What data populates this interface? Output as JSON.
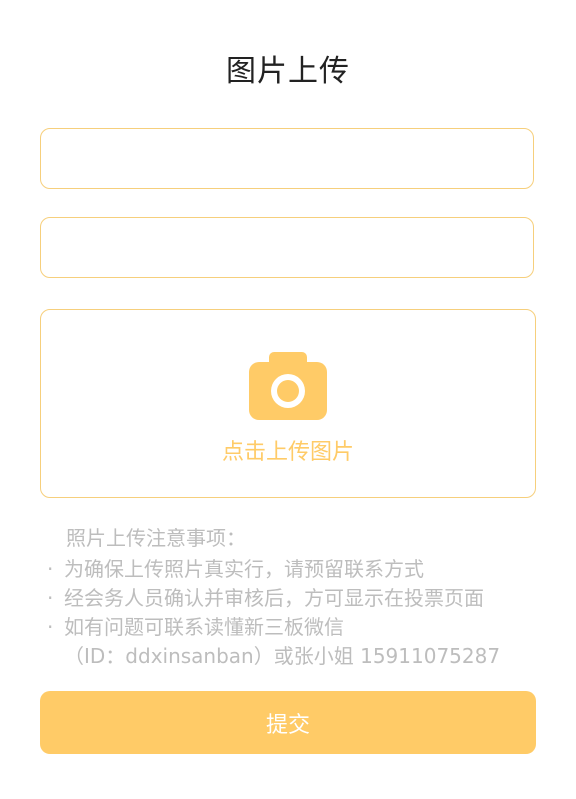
{
  "header": {
    "title": "图片上传"
  },
  "form": {
    "field_1": {
      "value": "",
      "placeholder": ""
    },
    "field_2": {
      "value": "",
      "placeholder": ""
    },
    "upload": {
      "icon": "camera-icon",
      "label": "点击上传图片"
    },
    "submit_label": "提交"
  },
  "notes": {
    "heading": "照片上传注意事项：",
    "bullet": "·",
    "items": [
      "为确保上传照片真实行，请预留联系方式",
      "经会务人员确认并审核后，方可显示在投票页面",
      "如有问题可联系读懂新三板微信"
    ],
    "contact_line": "（ID：ddxinsanban）或张小姐 15911075287"
  },
  "colors": {
    "accent": "#ffcb67",
    "border": "#f6cf7c",
    "note_text": "#bdbdbd",
    "title_text": "#222222"
  }
}
